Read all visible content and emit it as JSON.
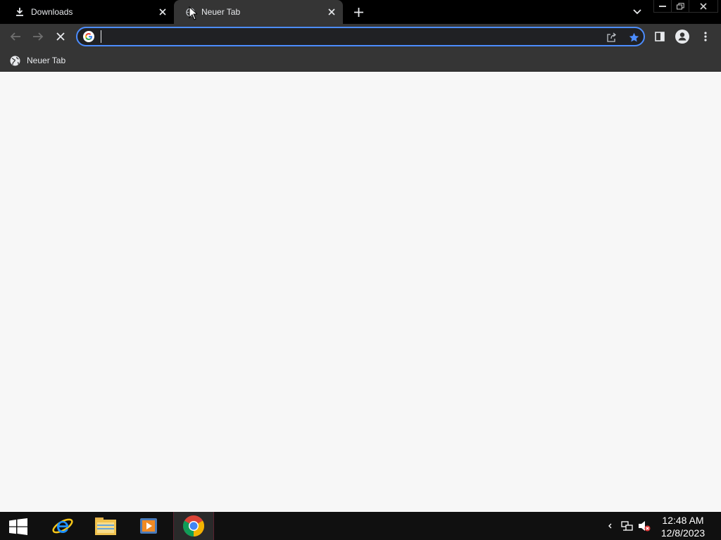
{
  "tabs": [
    {
      "title": "Downloads",
      "icon": "download-icon",
      "active": false
    },
    {
      "title": "Neuer Tab",
      "icon": "globe-icon",
      "active": true
    }
  ],
  "omnibox": {
    "value": "",
    "placeholder": ""
  },
  "bookmarks": [
    {
      "label": "Neuer Tab",
      "icon": "globe-icon"
    }
  ],
  "taskbar": {
    "apps": [
      "internet-explorer-icon",
      "file-explorer-icon",
      "media-player-icon",
      "chrome-icon"
    ],
    "clock": {
      "time": "12:48 AM",
      "date": "12/8/2023"
    }
  },
  "colors": {
    "tabstrip": "#000000",
    "toolbar": "#353535",
    "omnibox_border": "#4c8dff",
    "star": "#4c8dff",
    "content": "#f7f7f7",
    "taskbar": "#101010"
  }
}
